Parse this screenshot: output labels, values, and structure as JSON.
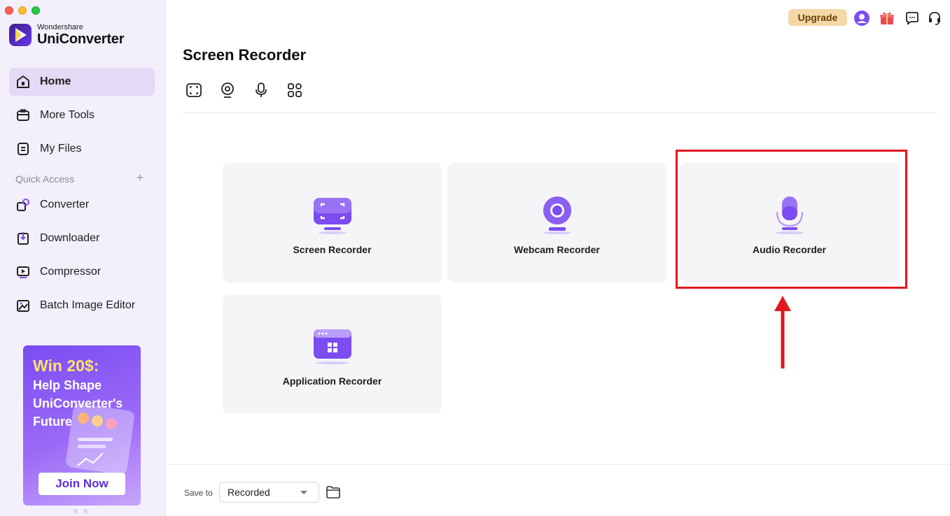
{
  "window": {
    "traffic_lights": [
      "close",
      "minimize",
      "zoom"
    ]
  },
  "brand": {
    "company": "Wondershare",
    "product": "UniConverter"
  },
  "sidebar": {
    "main_items": [
      {
        "label": "Home",
        "icon": "home-icon",
        "active": true
      },
      {
        "label": "More Tools",
        "icon": "tools-icon"
      },
      {
        "label": "My Files",
        "icon": "files-icon"
      }
    ],
    "quick_access_label": "Quick Access",
    "quick_access_add": "+",
    "quick_items": [
      {
        "label": "Converter",
        "icon": "converter-icon"
      },
      {
        "label": "Downloader",
        "icon": "downloader-icon"
      },
      {
        "label": "Compressor",
        "icon": "compressor-icon"
      },
      {
        "label": "Batch Image Editor",
        "icon": "image-editor-icon"
      }
    ],
    "promo": {
      "headline": "Win 20$:",
      "lines": [
        "Help Shape",
        "UniConverter's",
        "Future"
      ],
      "button": "Join Now"
    }
  },
  "header": {
    "upgrade_label": "Upgrade",
    "icons": [
      "avatar-icon",
      "gift-icon",
      "chat-icon",
      "support-icon"
    ]
  },
  "main": {
    "title": "Screen Recorder",
    "tabs": [
      "screen-capture-icon",
      "webcam-icon",
      "audio-icon",
      "apps-grid-icon"
    ],
    "cards": [
      {
        "label": "Screen Recorder",
        "icon": "screen-recorder-icon"
      },
      {
        "label": "Webcam Recorder",
        "icon": "webcam-recorder-icon"
      },
      {
        "label": "Audio Recorder",
        "icon": "microphone-icon",
        "highlighted": true
      },
      {
        "label": "Application Recorder",
        "icon": "application-recorder-icon"
      }
    ]
  },
  "footer": {
    "save_to_label": "Save to",
    "save_to_value": "Recorded"
  },
  "colors": {
    "accent": "#7b4cf0",
    "highlight": "#e0181f",
    "sidebar_bg": "#f3effb",
    "upgrade_bg": "#f5d8a8"
  }
}
